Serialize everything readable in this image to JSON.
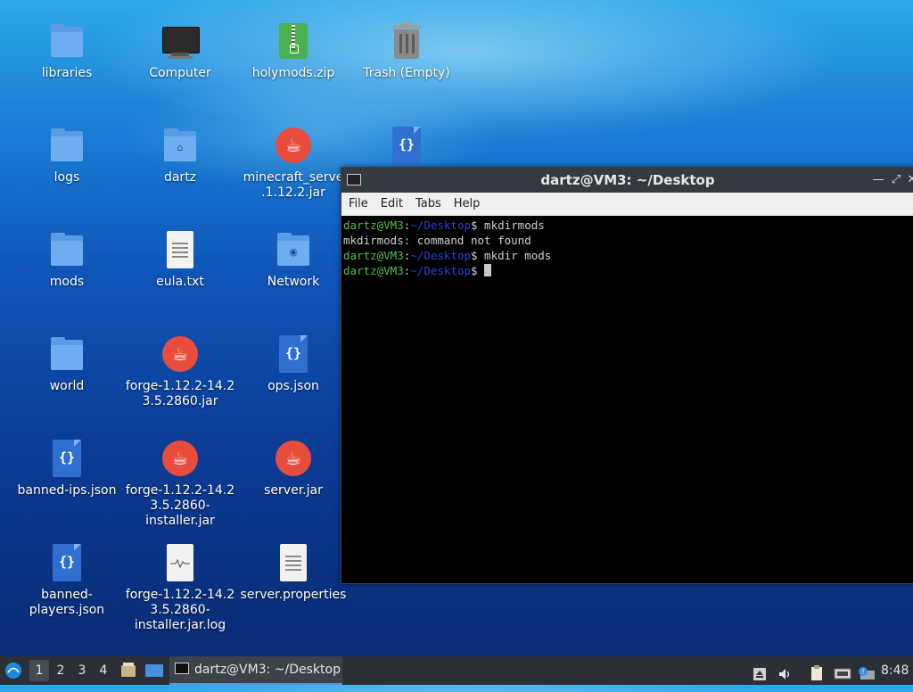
{
  "desktop": {
    "icons": [
      {
        "label": "libraries",
        "icon": "folder-icon"
      },
      {
        "label": "Computer",
        "icon": "computer-icon"
      },
      {
        "label": "holymods.zip",
        "icon": "zip-archive-icon"
      },
      {
        "label": "Trash (Empty)",
        "icon": "trash-icon"
      },
      {
        "label": "logs",
        "icon": "folder-icon"
      },
      {
        "label": "dartz",
        "icon": "home-folder-icon"
      },
      {
        "label": "minecraft_serve\n.1.12.2.jar",
        "icon": "java-icon"
      },
      {
        "label": "",
        "icon": "json-file-icon"
      },
      {
        "label": "mods",
        "icon": "folder-icon"
      },
      {
        "label": "eula.txt",
        "icon": "text-file-icon"
      },
      {
        "label": "Network",
        "icon": "network-folder-icon"
      },
      {
        "label": "world",
        "icon": "folder-icon"
      },
      {
        "label": "forge-1.12.2-14.2\n3.5.2860.jar",
        "icon": "java-icon"
      },
      {
        "label": "ops.json",
        "icon": "json-file-icon"
      },
      {
        "label": "banned-ips.json",
        "icon": "json-file-icon"
      },
      {
        "label": "forge-1.12.2-14.2\n3.5.2860-\ninstaller.jar",
        "icon": "java-icon"
      },
      {
        "label": "server.jar",
        "icon": "java-icon"
      },
      {
        "label": "banned-\nplayers.json",
        "icon": "json-file-icon"
      },
      {
        "label": "forge-1.12.2-14.2\n3.5.2860-\ninstaller.jar.log",
        "icon": "log-file-icon"
      },
      {
        "label": "server.properties",
        "icon": "text-file-icon"
      }
    ]
  },
  "terminal": {
    "title": "dartz@VM3: ~/Desktop",
    "menu": [
      "File",
      "Edit",
      "Tabs",
      "Help"
    ],
    "user_host": "dartz@VM3",
    "path": "~/Desktop",
    "lines": [
      {
        "type": "prompt",
        "cmd": " mkdirmods"
      },
      {
        "type": "output",
        "text": "mkdirmods: command not found"
      },
      {
        "type": "prompt",
        "cmd": " mkdir mods"
      },
      {
        "type": "prompt",
        "cmd": " "
      }
    ],
    "colors": {
      "user": "#4fc04f",
      "path": "#2a3fd6",
      "background": "#000000"
    }
  },
  "taskbar": {
    "workspaces": [
      "1",
      "2",
      "3",
      "4"
    ],
    "active_workspace": "1",
    "window_button": "dartz@VM3: ~/Desktop",
    "clock": "8:48",
    "tray_icons": [
      "eject-icon",
      "volume-icon",
      "clipboard-icon",
      "network-icon",
      "update-notifier-icon"
    ]
  }
}
